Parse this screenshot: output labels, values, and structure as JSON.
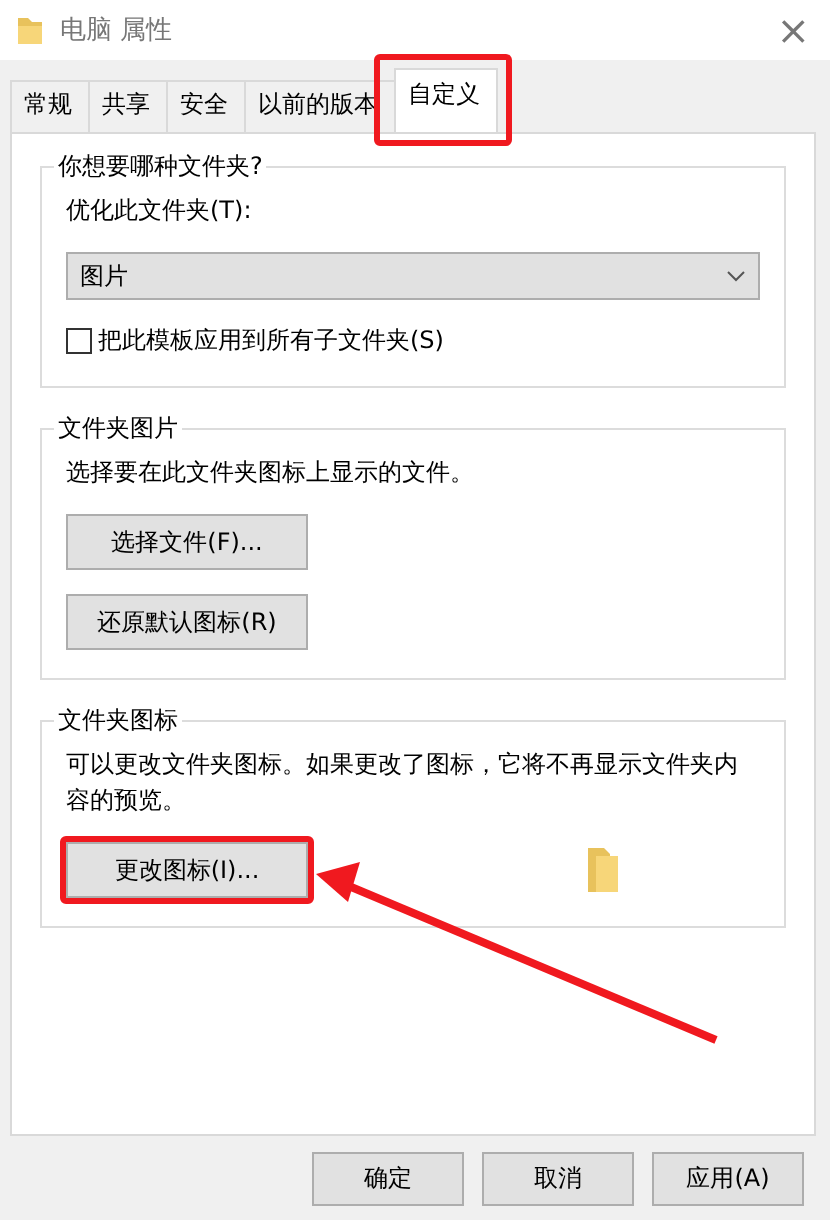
{
  "window": {
    "title": "电脑 属性",
    "close": "×"
  },
  "tabs": [
    {
      "label": "常规",
      "selected": false,
      "highlighted": false
    },
    {
      "label": "共享",
      "selected": false,
      "highlighted": false
    },
    {
      "label": "安全",
      "selected": false,
      "highlighted": false
    },
    {
      "label": "以前的版本",
      "selected": false,
      "highlighted": false
    },
    {
      "label": "自定义",
      "selected": true,
      "highlighted": true
    }
  ],
  "groups": [
    {
      "title": "你想要哪种文件夹?",
      "items": [
        {
          "kind": "label",
          "text": "优化此文件夹(T):"
        },
        {
          "kind": "dropdown",
          "value": "图片"
        },
        {
          "kind": "checkbox",
          "label": "把此模板应用到所有子文件夹(S)",
          "checked": false
        }
      ]
    },
    {
      "title": "文件夹图片",
      "items": [
        {
          "kind": "label",
          "text": "选择要在此文件夹图标上显示的文件。"
        },
        {
          "kind": "button",
          "label": "选择文件(F)...",
          "highlighted": false
        },
        {
          "kind": "button",
          "label": "还原默认图标(R)",
          "highlighted": false
        }
      ]
    },
    {
      "title": "文件夹图标",
      "items": [
        {
          "kind": "label",
          "text": "可以更改文件夹图标。如果更改了图标，它将不再显示文件夹内容的预览。"
        },
        {
          "kind": "icon_button",
          "label": "更改图标(I)...",
          "highlighted": true
        }
      ]
    }
  ],
  "buttons": [
    {
      "label": "确定"
    },
    {
      "label": "取消"
    },
    {
      "label": "应用(A)"
    }
  ]
}
